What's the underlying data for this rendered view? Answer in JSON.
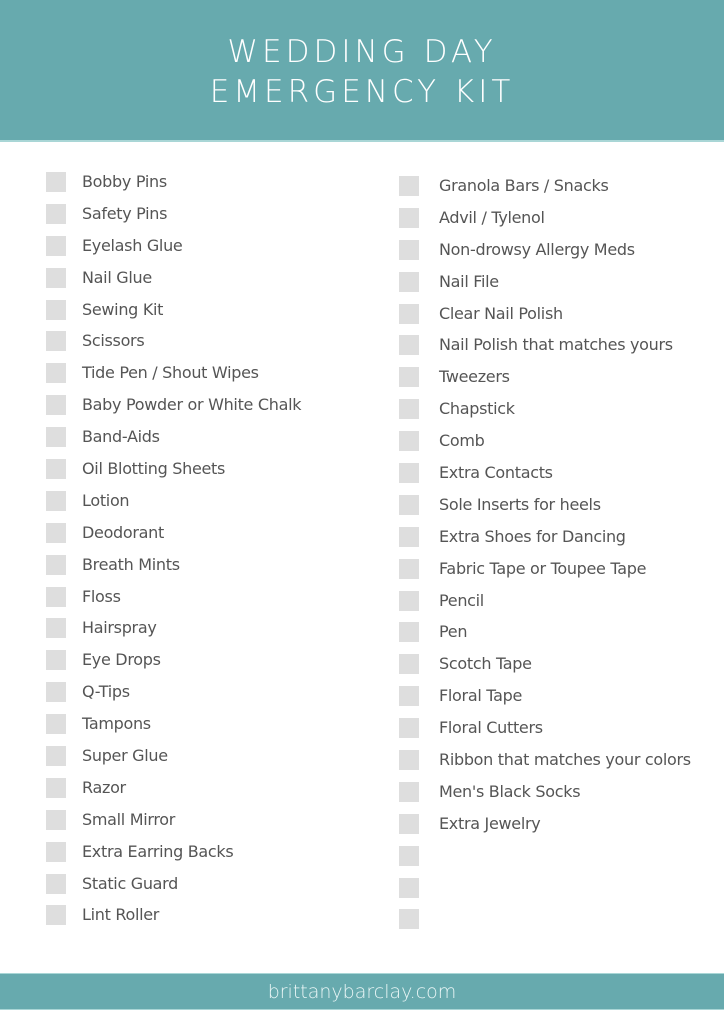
{
  "header": {
    "title_line1": "WEDDING DAY",
    "title_line2": "EMERGENCY KIT",
    "background_color": "#67aaae"
  },
  "left_column": {
    "items": [
      {
        "label": "Bobby Pins",
        "checked": false
      },
      {
        "label": "Safety Pins",
        "checked": false
      },
      {
        "label": "Eyelash Glue",
        "checked": false
      },
      {
        "label": "Nail Glue",
        "checked": false
      },
      {
        "label": "Sewing Kit",
        "checked": false
      },
      {
        "label": "Scissors",
        "checked": false
      },
      {
        "label": "Tide Pen / Shout Wipes",
        "checked": false
      },
      {
        "label": "Baby Powder or White Chalk",
        "checked": false
      },
      {
        "label": "Band-Aids",
        "checked": false
      },
      {
        "label": "Oil Blotting Sheets",
        "checked": false
      },
      {
        "label": "Lotion",
        "checked": false
      },
      {
        "label": "Deodorant",
        "checked": false
      },
      {
        "label": "Breath Mints",
        "checked": false
      },
      {
        "label": "Floss",
        "checked": false
      },
      {
        "label": "Hairspray",
        "checked": false
      },
      {
        "label": "Eye Drops",
        "checked": false
      },
      {
        "label": "Q-Tips",
        "checked": false
      },
      {
        "label": "Tampons",
        "checked": false
      },
      {
        "label": "Super Glue",
        "checked": false
      },
      {
        "label": "Razor",
        "checked": false
      },
      {
        "label": "Small Mirror",
        "checked": false
      },
      {
        "label": "Extra Earring Backs",
        "checked": false
      },
      {
        "label": "Static Guard",
        "checked": false
      },
      {
        "label": "Lint Roller",
        "checked": false
      }
    ]
  },
  "right_column": {
    "items": [
      {
        "label": "Granola Bars / Snacks",
        "checked": false
      },
      {
        "label": "Advil / Tylenol",
        "checked": false
      },
      {
        "label": "Non-drowsy Allergy Meds",
        "checked": false
      },
      {
        "label": "Nail File",
        "checked": false
      },
      {
        "label": "Clear Nail Polish",
        "checked": false
      },
      {
        "label": "Nail Polish that matches yours",
        "checked": false
      },
      {
        "label": "Tweezers",
        "checked": false
      },
      {
        "label": "Chapstick",
        "checked": false
      },
      {
        "label": "Comb",
        "checked": false
      },
      {
        "label": "Extra Contacts",
        "checked": false
      },
      {
        "label": "Sole Inserts for heels",
        "checked": false
      },
      {
        "label": "Extra Shoes for Dancing",
        "checked": false
      },
      {
        "label": "Fabric Tape or Toupee Tape",
        "checked": false
      },
      {
        "label": "Pencil",
        "checked": false
      },
      {
        "label": "Pen",
        "checked": false
      },
      {
        "label": "Scotch Tape",
        "checked": false
      },
      {
        "label": "Floral Tape",
        "checked": false
      },
      {
        "label": "Floral Cutters",
        "checked": false
      },
      {
        "label": "Ribbon that matches your colors",
        "checked": false
      },
      {
        "label": "Men's Black Socks",
        "checked": false
      },
      {
        "label": "Extra Jewelry",
        "checked": false
      },
      {
        "label": "",
        "checked": false
      },
      {
        "label": "",
        "checked": false
      },
      {
        "label": "",
        "checked": false
      }
    ]
  },
  "footer": {
    "website": "brittanybarclay.com"
  }
}
